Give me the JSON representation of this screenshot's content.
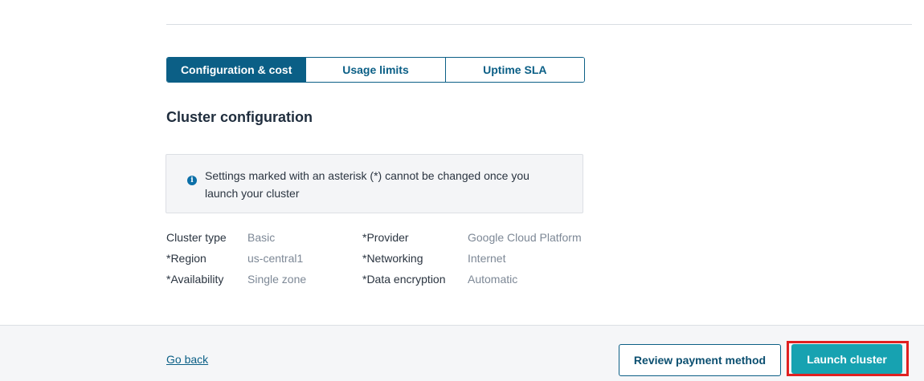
{
  "tabs": [
    {
      "label": "Configuration & cost",
      "active": true
    },
    {
      "label": "Usage limits",
      "active": false
    },
    {
      "label": "Uptime SLA",
      "active": false
    }
  ],
  "section": {
    "title": "Cluster configuration"
  },
  "notice": {
    "icon": "info-icon",
    "icon_glyph": "i",
    "text": "Settings marked with an asterisk (*) cannot be changed once you launch your cluster"
  },
  "specs": [
    {
      "label": "Cluster type",
      "value": "Basic",
      "label2": "*Provider",
      "value2": "Google Cloud Platform"
    },
    {
      "label": "*Region",
      "value": "us-central1",
      "label2": "*Networking",
      "value2": "Internet"
    },
    {
      "label": "*Availability",
      "value": "Single zone",
      "label2": "*Data encryption",
      "value2": "Automatic"
    }
  ],
  "footer": {
    "go_back": "Go back",
    "review_payment": "Review payment method",
    "launch": "Launch cluster"
  },
  "colors": {
    "primary": "#0b5f86",
    "launch_button": "#17a2b1",
    "highlight": "#e02020"
  }
}
